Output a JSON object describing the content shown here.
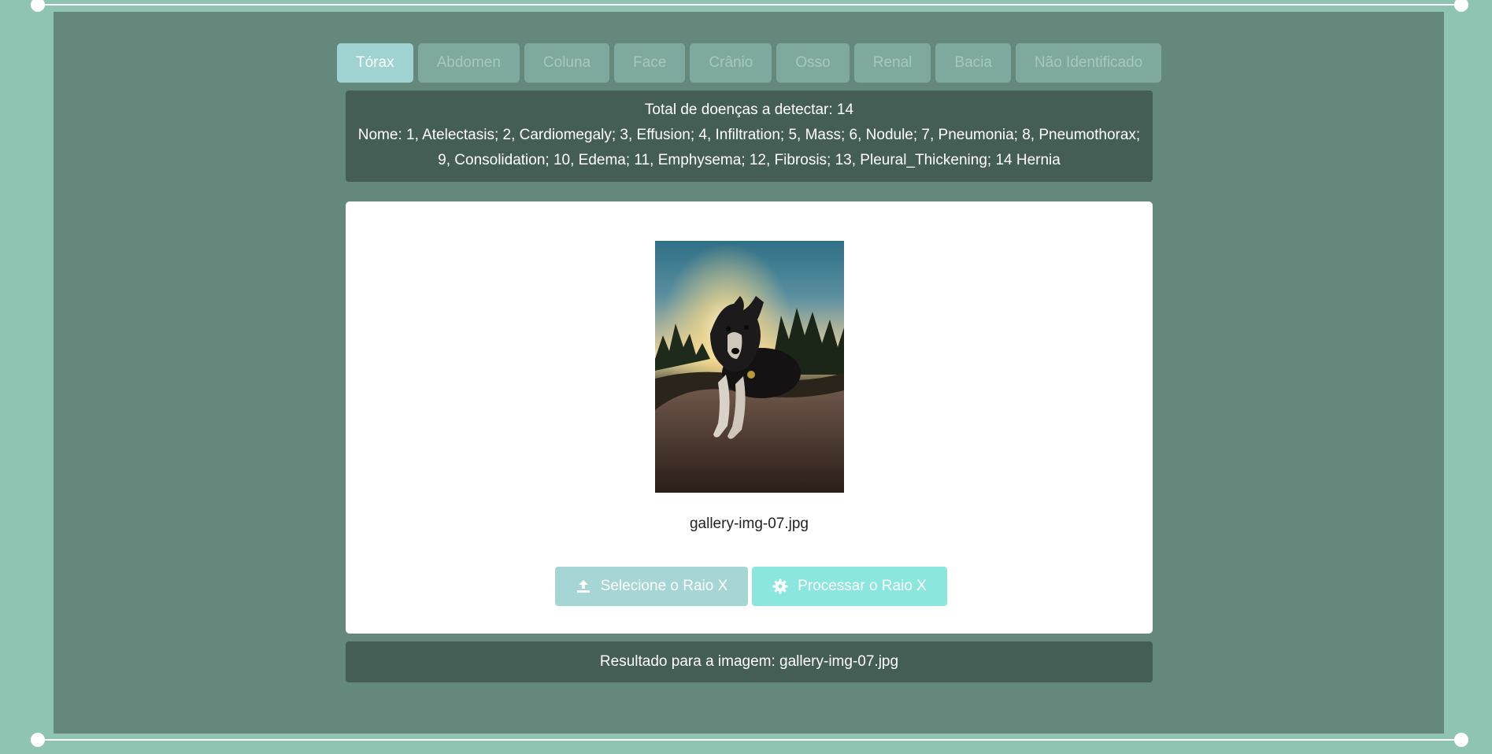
{
  "tabs": [
    {
      "label": "Tórax",
      "active": true
    },
    {
      "label": "Abdomen",
      "active": false
    },
    {
      "label": "Coluna",
      "active": false
    },
    {
      "label": "Face",
      "active": false
    },
    {
      "label": "Crânio",
      "active": false
    },
    {
      "label": "Osso",
      "active": false
    },
    {
      "label": "Renal",
      "active": false
    },
    {
      "label": "Bacia",
      "active": false
    },
    {
      "label": "Não Identificado",
      "active": false
    }
  ],
  "info": {
    "total_line": "Total de doenças a detectar: 14",
    "names_line_1": "Nome: 1, Atelectasis; 2, Cardiomegaly; 3, Effusion; 4, Infiltration; 5, Mass; 6, Nodule; 7, Pneumonia; 8, Pneumothorax;",
    "names_line_2": "9, Consolidation; 10, Edema; 11, Emphysema; 12, Fibrosis; 13, Pleural_Thickening; 14 Hernia"
  },
  "preview": {
    "filename": "gallery-img-07.jpg"
  },
  "buttons": {
    "select_label": "Selecione o Raio X",
    "select_icon": "upload-icon",
    "process_label": "Processar o Raio X",
    "process_icon": "gear-icon"
  },
  "result": {
    "text": "Resultado para a imagem: gallery-img-07.jpg"
  },
  "colors": {
    "page_bg": "#8fc4b3",
    "stage_bg": "#64897c",
    "panel_bg": "#455e55",
    "tab_active": "#9fd3d2",
    "tab_inactive": "#7fa99f",
    "select_button": "#a5d6d5",
    "process_button": "#8be7de"
  }
}
